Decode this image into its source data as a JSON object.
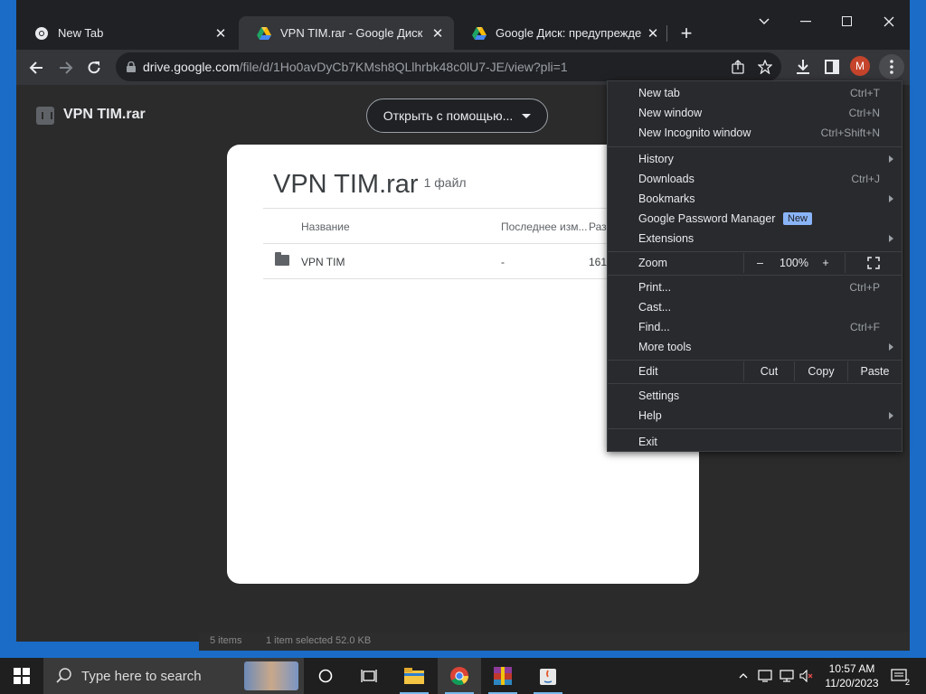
{
  "browser": {
    "tabs": [
      {
        "title": "New Tab",
        "favicon": "chrome-icon",
        "active": false
      },
      {
        "title": "VPN TIM.rar - Google Диск",
        "favicon": "google-drive-icon",
        "active": true
      },
      {
        "title": "Google Диск: предупреждение",
        "favicon": "google-drive-icon",
        "active": false
      }
    ],
    "url_domain": "drive.google.com",
    "url_path": "/file/d/1Ho0avDyCb7KMsh8QLlhrbk48c0lU7-JE/view?pli=1",
    "profile_initial": "M"
  },
  "viewer": {
    "file_title": "VPN TIM.rar",
    "open_with_label": "Открыть с помощью..."
  },
  "archive": {
    "title": "VPN TIM.rar",
    "file_count": "1 файл",
    "columns": [
      "Название",
      "Последнее изм...",
      "Раз"
    ],
    "rows": [
      {
        "name": "VPN TIM",
        "modified": "-",
        "size": "161"
      }
    ]
  },
  "menu": {
    "new_tab": {
      "label": "New tab",
      "shortcut": "Ctrl+T"
    },
    "new_window": {
      "label": "New window",
      "shortcut": "Ctrl+N"
    },
    "new_incognito": {
      "label": "New Incognito window",
      "shortcut": "Ctrl+Shift+N"
    },
    "history": {
      "label": "History"
    },
    "downloads": {
      "label": "Downloads",
      "shortcut": "Ctrl+J"
    },
    "bookmarks": {
      "label": "Bookmarks"
    },
    "password_manager": {
      "label": "Google Password Manager",
      "badge": "New"
    },
    "extensions": {
      "label": "Extensions"
    },
    "zoom": {
      "label": "Zoom",
      "minus": "–",
      "level": "100%",
      "plus": "+"
    },
    "print": {
      "label": "Print...",
      "shortcut": "Ctrl+P"
    },
    "cast": {
      "label": "Cast..."
    },
    "find": {
      "label": "Find...",
      "shortcut": "Ctrl+F"
    },
    "more_tools": {
      "label": "More tools"
    },
    "edit": {
      "label": "Edit",
      "cut": "Cut",
      "copy": "Copy",
      "paste": "Paste"
    },
    "settings": {
      "label": "Settings"
    },
    "help": {
      "label": "Help"
    },
    "exit": {
      "label": "Exit"
    }
  },
  "behind_window": {
    "items_text": "5 items",
    "selected_text": "1 item selected  52.0 KB"
  },
  "taskbar": {
    "search_placeholder": "Type here to search",
    "time": "10:57 AM",
    "date": "11/20/2023",
    "notification_count": "2"
  },
  "colors": {
    "accent_blue": "#8ab4f8",
    "avatar": "#c5442b",
    "chrome_dark": "#202124",
    "desktop": "#1a6cc7"
  }
}
